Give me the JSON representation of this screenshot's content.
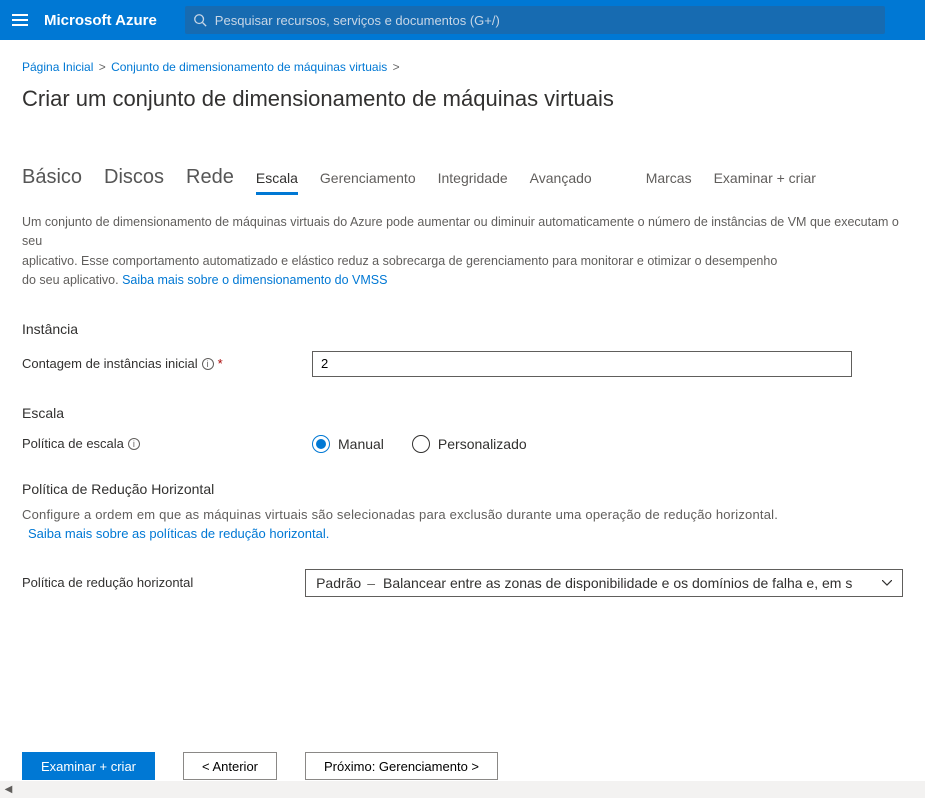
{
  "header": {
    "brand": "Microsoft Azure",
    "search_placeholder": "Pesquisar recursos, serviços e documentos (G+/)"
  },
  "breadcrumb": {
    "home": "Página Inicial",
    "vmss": "Conjunto de dimensionamento de máquinas virtuais"
  },
  "page_title": "Criar um conjunto de dimensionamento de máquinas virtuais",
  "tabs": {
    "basic": "Básico",
    "disks": "Discos",
    "network": "Rede",
    "scale": "Escala",
    "management": "Gerenciamento",
    "health": "Integridade",
    "advanced": "Avançado",
    "tags": "Marcas",
    "review": "Examinar + criar"
  },
  "intro": {
    "line1": "Um conjunto de dimensionamento de máquinas virtuais do Azure pode aumentar ou diminuir automaticamente o número de instâncias de VM que executam o seu",
    "line2": "aplicativo. Esse comportamento automatizado e elástico reduz a sobrecarga de gerenciamento para monitorar e otimizar o desempenho",
    "line3a": "do seu aplicativo. ",
    "link": "Saiba mais sobre o dimensionamento do VMSS"
  },
  "instance": {
    "heading": "Instância",
    "count_label": "Contagem de instâncias inicial",
    "count_value": "2"
  },
  "scale": {
    "heading": "Escala",
    "policy_label": "Política de escala",
    "option_manual": "Manual",
    "option_custom": "Personalizado"
  },
  "scalein": {
    "heading": "Política de Redução Horizontal",
    "desc": "Configure a ordem em que as máquinas virtuais são selecionadas para exclusão durante uma operação de redução horizontal.",
    "link": "Saiba mais sobre as políticas de redução horizontal.",
    "label": "Política de redução horizontal",
    "dd_prefix": "Padrão",
    "dd_sep": "–",
    "dd_body": "Balancear entre as zonas de disponibilidade e os domínios de falha e, em s"
  },
  "footer": {
    "review": "Examinar + criar",
    "prev": "< Anterior",
    "next": "Próximo: Gerenciamento >"
  }
}
